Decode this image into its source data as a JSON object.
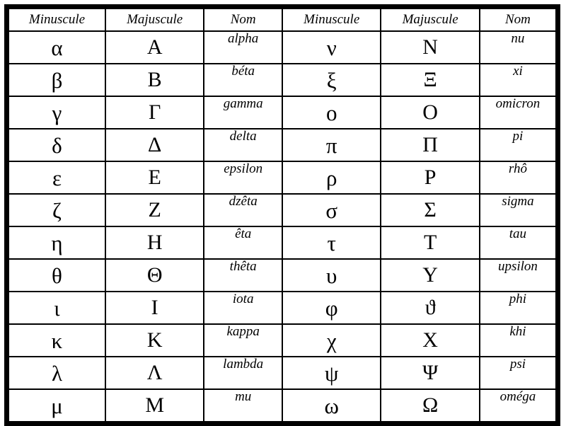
{
  "table": {
    "headers": {
      "minuscule": "Minuscule",
      "majuscule": "Majuscule",
      "nom": "Nom"
    },
    "columns_repeat": 2,
    "colors": {
      "border": "#000000",
      "background": "#ffffff",
      "text": "#000000"
    },
    "rows": [
      {
        "left": {
          "minuscule": "α",
          "majuscule": "Α",
          "nom": "alpha"
        },
        "right": {
          "minuscule": "ν",
          "majuscule": "Ν",
          "nom": "nu"
        }
      },
      {
        "left": {
          "minuscule": "β",
          "majuscule": "Β",
          "nom": "béta"
        },
        "right": {
          "minuscule": "ξ",
          "majuscule": "Ξ",
          "nom": "xi"
        }
      },
      {
        "left": {
          "minuscule": "γ",
          "majuscule": "Γ",
          "nom": "gamma"
        },
        "right": {
          "minuscule": "ο",
          "majuscule": "Ο",
          "nom": "omicron"
        }
      },
      {
        "left": {
          "minuscule": "δ",
          "majuscule": "Δ",
          "nom": "delta"
        },
        "right": {
          "minuscule": "π",
          "majuscule": "Π",
          "nom": "pi"
        }
      },
      {
        "left": {
          "minuscule": "ε",
          "majuscule": "Ε",
          "nom": "epsilon"
        },
        "right": {
          "minuscule": "ρ",
          "majuscule": "Ρ",
          "nom": "rhô"
        }
      },
      {
        "left": {
          "minuscule": "ζ",
          "majuscule": "Ζ",
          "nom": "dzêta"
        },
        "right": {
          "minuscule": "σ",
          "majuscule": "Σ",
          "nom": "sigma"
        }
      },
      {
        "left": {
          "minuscule": "η",
          "majuscule": "Η",
          "nom": "êta"
        },
        "right": {
          "minuscule": "τ",
          "majuscule": "Τ",
          "nom": "tau"
        }
      },
      {
        "left": {
          "minuscule": "θ",
          "majuscule": "Θ",
          "nom": "thêta"
        },
        "right": {
          "minuscule": "υ",
          "majuscule": "Υ",
          "nom": "upsilon"
        }
      },
      {
        "left": {
          "minuscule": "ι",
          "majuscule": "Ι",
          "nom": "iota"
        },
        "right": {
          "minuscule": "φ",
          "majuscule": "ϑ",
          "nom": "phi"
        }
      },
      {
        "left": {
          "minuscule": "κ",
          "majuscule": "Κ",
          "nom": "kappa"
        },
        "right": {
          "minuscule": "χ",
          "majuscule": "Χ",
          "nom": "khi"
        }
      },
      {
        "left": {
          "minuscule": "λ",
          "majuscule": "Λ",
          "nom": "lambda"
        },
        "right": {
          "minuscule": "ψ",
          "majuscule": "Ψ",
          "nom": "psi"
        }
      },
      {
        "left": {
          "minuscule": "μ",
          "majuscule": "Μ",
          "nom": "mu"
        },
        "right": {
          "minuscule": "ω",
          "majuscule": "Ω",
          "nom": "oméga"
        }
      }
    ]
  }
}
